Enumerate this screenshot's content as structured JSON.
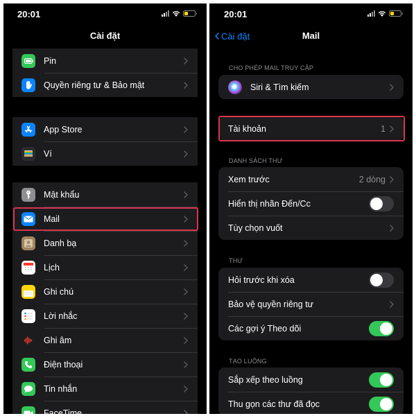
{
  "left": {
    "status": {
      "time": "20:01"
    },
    "nav": {
      "title": "Cài đặt"
    },
    "group1": [
      {
        "label": "Pin",
        "icon": "battery-app-icon",
        "color": "#34c759"
      },
      {
        "label": "Quyền riêng tư & Bảo mật",
        "icon": "hand-app-icon",
        "color": "#0a84ff"
      }
    ],
    "group2": [
      {
        "label": "App Store",
        "icon": "appstore-app-icon",
        "color": "#0a84ff"
      },
      {
        "label": "Ví",
        "icon": "wallet-app-icon",
        "color": "#2c2c2e"
      }
    ],
    "group3": [
      {
        "label": "Mật khẩu",
        "icon": "key-app-icon",
        "color": "#8e8e93"
      },
      {
        "label": "Mail",
        "icon": "mail-app-icon",
        "color": "#0a84ff"
      },
      {
        "label": "Danh bạ",
        "icon": "contacts-app-icon",
        "color": "#a2845e"
      },
      {
        "label": "Lịch",
        "icon": "calendar-app-icon",
        "color": "#ffffff"
      },
      {
        "label": "Ghi chú",
        "icon": "notes-app-icon",
        "color": "#ffd60a"
      },
      {
        "label": "Lời nhắc",
        "icon": "reminders-app-icon",
        "color": "#ffffff"
      },
      {
        "label": "Ghi âm",
        "icon": "voice-memos-app-icon",
        "color": "#1c1c1e"
      },
      {
        "label": "Điện thoại",
        "icon": "phone-app-icon",
        "color": "#34c759"
      },
      {
        "label": "Tin nhắn",
        "icon": "messages-app-icon",
        "color": "#34c759"
      },
      {
        "label": "FaceTime",
        "icon": "facetime-app-icon",
        "color": "#34c759"
      }
    ]
  },
  "right": {
    "status": {
      "time": "20:01"
    },
    "nav": {
      "back": "Cài đặt",
      "title": "Mail"
    },
    "section1": {
      "header": "CHO PHÉP MAIL TRUY CẬP",
      "rows": [
        {
          "label": "Siri & Tìm kiếm"
        }
      ]
    },
    "accounts": {
      "label": "Tài khoản",
      "value": "1"
    },
    "section2": {
      "header": "DANH SÁCH THƯ",
      "rows": [
        {
          "label": "Xem trước",
          "value": "2 dòng"
        },
        {
          "label": "Hiển thị nhãn Đến/Cc",
          "toggle": "off"
        },
        {
          "label": "Tùy chọn vuốt"
        }
      ]
    },
    "section3": {
      "header": "THƯ",
      "rows": [
        {
          "label": "Hỏi trước khi xóa",
          "toggle": "off"
        },
        {
          "label": "Bảo vệ quyền riêng tư"
        },
        {
          "label": "Các gợi ý Theo dõi",
          "toggle": "on"
        }
      ]
    },
    "section4": {
      "header": "TẠO LUỒNG",
      "rows": [
        {
          "label": "Sắp xếp theo luồng",
          "toggle": "on"
        },
        {
          "label": "Thu gọn các thư đã đọc",
          "toggle": "on"
        }
      ]
    }
  },
  "colors": {
    "accent": "#0a84ff",
    "toggle_on": "#34c759",
    "highlight": "#d9354f"
  }
}
